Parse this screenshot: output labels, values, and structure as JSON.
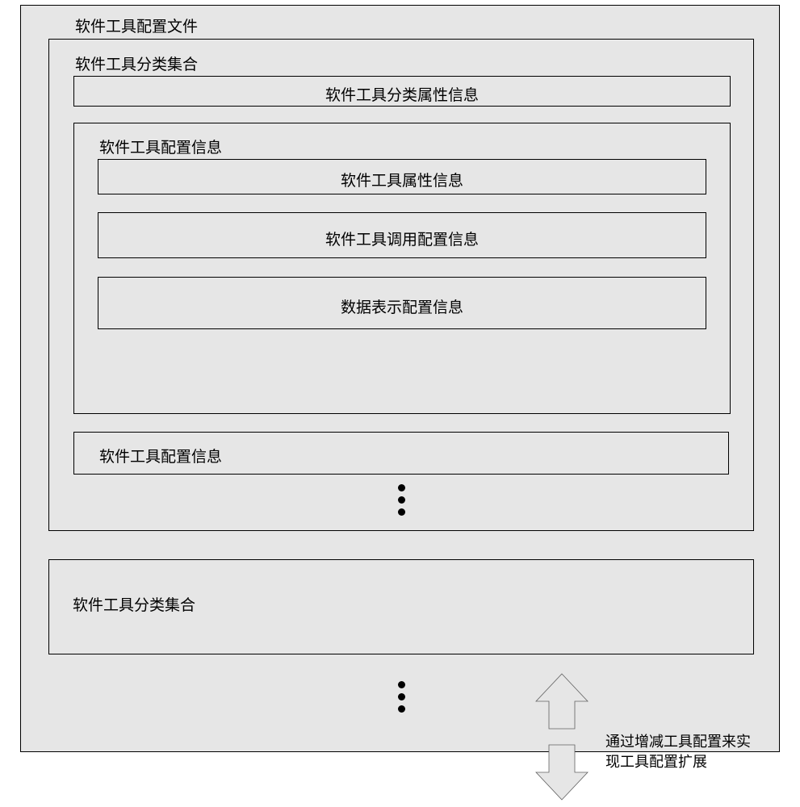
{
  "outer": {
    "title": "软件工具配置文件"
  },
  "categorySet1": {
    "title": "软件工具分类集合",
    "attrBox": "软件工具分类属性信息",
    "config1": {
      "title": "软件工具配置信息",
      "items": {
        "attr": "软件工具属性信息",
        "invoke": "软件工具调用配置信息",
        "data": "数据表示配置信息"
      }
    },
    "config2": {
      "title": "软件工具配置信息"
    }
  },
  "categorySet2": {
    "title": "软件工具分类集合"
  },
  "note": {
    "line1": "通过增减工具配置来实",
    "line2": "现工具配置扩展"
  }
}
